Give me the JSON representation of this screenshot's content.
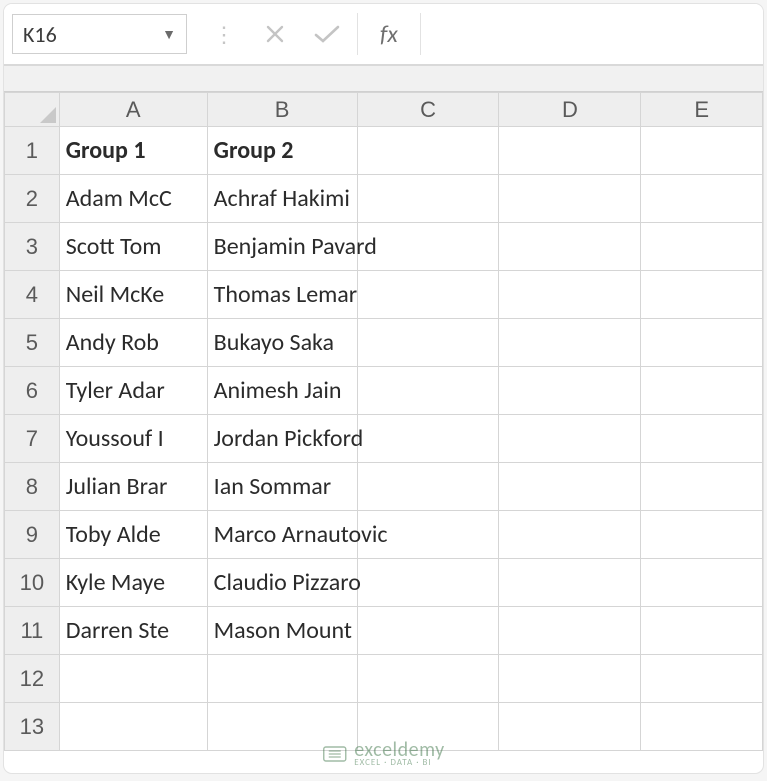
{
  "name_box": "K16",
  "fx_label": "fx",
  "formula_value": "",
  "columns": [
    "A",
    "B",
    "C",
    "D",
    "E"
  ],
  "row_count": 13,
  "headers": {
    "A": "Group 1",
    "B": "Group 2"
  },
  "rows": [
    {
      "A": "Adam McC",
      "B": "Achraf Hakimi"
    },
    {
      "A": "Scott Tom",
      "B": "Benjamin Pavard"
    },
    {
      "A": "Neil McKe",
      "B": "Thomas Lemar"
    },
    {
      "A": "Andy Rob",
      "B": "Bukayo Saka"
    },
    {
      "A": "Tyler Adar",
      "B": "Animesh Jain"
    },
    {
      "A": "Youssouf I",
      "B": "Jordan Pickford"
    },
    {
      "A": "Julian Brar",
      "B": "Ian Sommar"
    },
    {
      "A": "Toby Alde",
      "B": "Marco Arnautovic"
    },
    {
      "A": "Kyle Maye",
      "B": "Claudio Pizzaro"
    },
    {
      "A": "Darren Ste",
      "B": "Mason Mount"
    }
  ],
  "watermark": {
    "text": "exceldemy",
    "sub": "EXCEL · DATA · BI"
  }
}
